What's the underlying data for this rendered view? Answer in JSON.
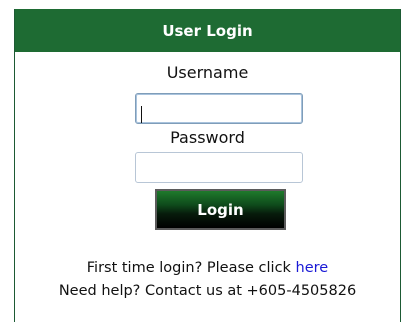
{
  "login": {
    "title": "User Login",
    "username_label": "Username",
    "username_value": "",
    "password_label": "Password",
    "password_value": "",
    "submit_label": "Login"
  },
  "footer": {
    "first_time_prefix": "First time login? Please click ",
    "first_time_link": "here",
    "help_text": "Need help? Contact us at +605-4505826"
  },
  "colors": {
    "header_bg": "#1e6b33",
    "link": "#1a1ad6"
  }
}
